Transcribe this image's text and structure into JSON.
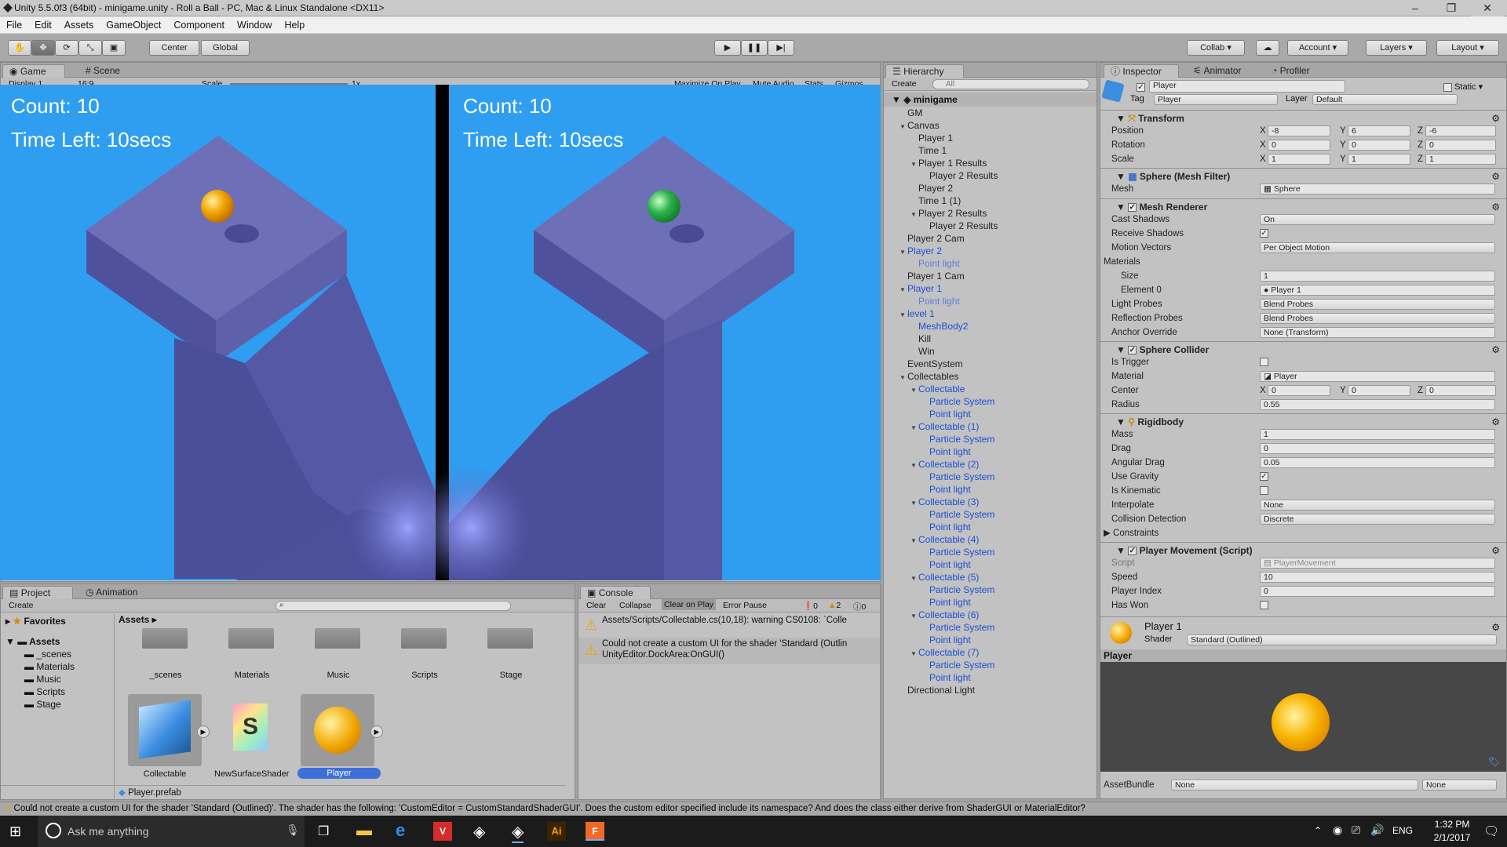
{
  "window": {
    "title": "Unity 5.5.0f3 (64bit) - minigame.unity - Roll a Ball - PC, Mac & Linux Standalone <DX11>",
    "minimize": "–",
    "maximize": "❐",
    "close": "✕"
  },
  "menu": [
    "File",
    "Edit",
    "Assets",
    "GameObject",
    "Component",
    "Window",
    "Help"
  ],
  "toolbar": {
    "center": "Center",
    "global": "Global",
    "collab": "Collab",
    "account": "Account",
    "layers": "Layers",
    "layout": "Layout"
  },
  "game": {
    "tab_game": "Game",
    "tab_scene": "Scene",
    "display": "Display 1",
    "aspect": "16:9",
    "scale_label": "Scale",
    "scale_value": "1x",
    "maximize": "Maximize On Play",
    "mute": "Mute Audio",
    "stats": "Stats",
    "gizmos": "Gizmos",
    "left_count": "Count: 10",
    "left_time": "Time Left: 10secs",
    "right_count": "Count: 10",
    "right_time": "Time Left: 10secs",
    "ball_left_color": "#f2a500",
    "ball_right_color": "#2bb24a"
  },
  "hierarchy": {
    "tab": "Hierarchy",
    "create": "Create",
    "search": "All",
    "scene": "minigame",
    "rows": [
      {
        "label": "GM",
        "depth": 1,
        "style": "",
        "tri": ""
      },
      {
        "label": "Canvas",
        "depth": 1,
        "style": "",
        "tri": "▼"
      },
      {
        "label": "Player 1",
        "depth": 2,
        "style": "",
        "tri": ""
      },
      {
        "label": "Time 1",
        "depth": 2,
        "style": "",
        "tri": ""
      },
      {
        "label": "Player 1 Results",
        "depth": 2,
        "style": "",
        "tri": "▼"
      },
      {
        "label": "Player 2 Results",
        "depth": 3,
        "style": "",
        "tri": ""
      },
      {
        "label": "Player 2",
        "depth": 2,
        "style": "",
        "tri": ""
      },
      {
        "label": "Time 1 (1)",
        "depth": 2,
        "style": "",
        "tri": ""
      },
      {
        "label": "Player 2 Results",
        "depth": 2,
        "style": "",
        "tri": "▼"
      },
      {
        "label": "Player 2 Results",
        "depth": 3,
        "style": "",
        "tri": ""
      },
      {
        "label": "Player 2 Cam",
        "depth": 1,
        "style": "",
        "tri": ""
      },
      {
        "label": "Player 2",
        "depth": 1,
        "style": "blue",
        "tri": "▼"
      },
      {
        "label": "Point light",
        "depth": 2,
        "style": "light",
        "tri": ""
      },
      {
        "label": "Player 1 Cam",
        "depth": 1,
        "style": "",
        "tri": ""
      },
      {
        "label": "Player 1",
        "depth": 1,
        "style": "blue",
        "tri": "▼"
      },
      {
        "label": "Point light",
        "depth": 2,
        "style": "light",
        "tri": ""
      },
      {
        "label": "level 1",
        "depth": 1,
        "style": "blue",
        "tri": "▼"
      },
      {
        "label": "MeshBody2",
        "depth": 2,
        "style": "blue",
        "tri": ""
      },
      {
        "label": "Kill",
        "depth": 2,
        "style": "",
        "tri": ""
      },
      {
        "label": "Win",
        "depth": 2,
        "style": "",
        "tri": ""
      },
      {
        "label": "EventSystem",
        "depth": 1,
        "style": "",
        "tri": ""
      },
      {
        "label": "Collectables",
        "depth": 1,
        "style": "",
        "tri": "▼"
      },
      {
        "label": "Collectable",
        "depth": 2,
        "style": "blue",
        "tri": "▼"
      },
      {
        "label": "Particle System",
        "depth": 3,
        "style": "blue",
        "tri": ""
      },
      {
        "label": "Point light",
        "depth": 3,
        "style": "blue",
        "tri": ""
      },
      {
        "label": "Collectable (1)",
        "depth": 2,
        "style": "blue",
        "tri": "▼"
      },
      {
        "label": "Particle System",
        "depth": 3,
        "style": "blue",
        "tri": ""
      },
      {
        "label": "Point light",
        "depth": 3,
        "style": "blue",
        "tri": ""
      },
      {
        "label": "Collectable (2)",
        "depth": 2,
        "style": "blue",
        "tri": "▼"
      },
      {
        "label": "Particle System",
        "depth": 3,
        "style": "blue",
        "tri": ""
      },
      {
        "label": "Point light",
        "depth": 3,
        "style": "blue",
        "tri": ""
      },
      {
        "label": "Collectable (3)",
        "depth": 2,
        "style": "blue",
        "tri": "▼"
      },
      {
        "label": "Particle System",
        "depth": 3,
        "style": "blue",
        "tri": ""
      },
      {
        "label": "Point light",
        "depth": 3,
        "style": "blue",
        "tri": ""
      },
      {
        "label": "Collectable (4)",
        "depth": 2,
        "style": "blue",
        "tri": "▼"
      },
      {
        "label": "Particle System",
        "depth": 3,
        "style": "blue",
        "tri": ""
      },
      {
        "label": "Point light",
        "depth": 3,
        "style": "blue",
        "tri": ""
      },
      {
        "label": "Collectable (5)",
        "depth": 2,
        "style": "blue",
        "tri": "▼"
      },
      {
        "label": "Particle System",
        "depth": 3,
        "style": "blue",
        "tri": ""
      },
      {
        "label": "Point light",
        "depth": 3,
        "style": "blue",
        "tri": ""
      },
      {
        "label": "Collectable (6)",
        "depth": 2,
        "style": "blue",
        "tri": "▼"
      },
      {
        "label": "Particle System",
        "depth": 3,
        "style": "blue",
        "tri": ""
      },
      {
        "label": "Point light",
        "depth": 3,
        "style": "blue",
        "tri": ""
      },
      {
        "label": "Collectable (7)",
        "depth": 2,
        "style": "blue",
        "tri": "▼"
      },
      {
        "label": "Particle System",
        "depth": 3,
        "style": "blue",
        "tri": ""
      },
      {
        "label": "Point light",
        "depth": 3,
        "style": "blue",
        "tri": ""
      },
      {
        "label": "Directional Light",
        "depth": 1,
        "style": "",
        "tri": ""
      }
    ]
  },
  "inspector": {
    "tabs": [
      "Inspector",
      "Animator",
      "Profiler"
    ],
    "name": "Player",
    "static": "Static",
    "tag_label": "Tag",
    "tag": "Player",
    "layer_label": "Layer",
    "layer": "Default",
    "transform": {
      "title": "Transform",
      "position": "Position",
      "rotation": "Rotation",
      "scale": "Scale",
      "x": "X",
      "y": "Y",
      "z": "Z",
      "pos": [
        "-8",
        "6",
        "-6"
      ],
      "rot": [
        "0",
        "0",
        "0"
      ],
      "scl": [
        "1",
        "1",
        "1"
      ]
    },
    "meshfilter": {
      "title": "Sphere (Mesh Filter)",
      "mesh_label": "Mesh",
      "mesh": "Sphere"
    },
    "renderer": {
      "title": "Mesh Renderer",
      "cast": "Cast Shadows",
      "cast_val": "On",
      "receive": "Receive Shadows",
      "motion": "Motion Vectors",
      "motion_val": "Per Object Motion",
      "materials": "Materials",
      "size": "Size",
      "size_val": "1",
      "element0": "Element 0",
      "element0_val": "Player 1",
      "lightprobes": "Light Probes",
      "lightprobes_val": "Blend Probes",
      "reflprobes": "Reflection Probes",
      "reflprobes_val": "Blend Probes",
      "anchor": "Anchor Override",
      "anchor_val": "None (Transform)"
    },
    "collider": {
      "title": "Sphere Collider",
      "trigger": "Is Trigger",
      "material": "Material",
      "material_val": "Player",
      "center": "Center",
      "center_vals": [
        "0",
        "0",
        "0"
      ],
      "radius": "Radius",
      "radius_val": "0.55"
    },
    "rigidbody": {
      "title": "Rigidbody",
      "mass": "Mass",
      "mass_val": "1",
      "drag": "Drag",
      "drag_val": "0",
      "adrag": "Angular Drag",
      "adrag_val": "0.05",
      "gravity": "Use Gravity",
      "kinematic": "Is Kinematic",
      "interp": "Interpolate",
      "interp_val": "None",
      "coll": "Collision Detection",
      "coll_val": "Discrete",
      "constraints": "Constraints"
    },
    "script": {
      "title": "Player Movement (Script)",
      "script": "Script",
      "script_val": "PlayerMovement",
      "speed": "Speed",
      "speed_val": "10",
      "index": "Player Index",
      "index_val": "0",
      "won": "Has Won"
    },
    "material": {
      "name": "Player 1",
      "shader_label": "Shader",
      "shader": "Standard (Outlined)"
    },
    "preview_title": "Player",
    "assetbundle": "AssetBundle",
    "ab_val": "None",
    "ab_val2": "None"
  },
  "project": {
    "tab_project": "Project",
    "tab_animation": "Animation",
    "create": "Create",
    "favorites": "Favorites",
    "assets_root": "Assets",
    "folders": [
      "_scenes",
      "Materials",
      "Music",
      "Scripts",
      "Stage"
    ],
    "breadcrumb": "Assets",
    "grid_folders": [
      "_scenes",
      "Materials",
      "Music",
      "Scripts",
      "Stage"
    ],
    "assets": [
      "Collectable",
      "NewSurfaceShader",
      "Player"
    ],
    "selected_file": "Player.prefab"
  },
  "console": {
    "tab": "Console",
    "clear": "Clear",
    "collapse": "Collapse",
    "clear_on_play": "Clear on Play",
    "error_pause": "Error Pause",
    "counts": [
      "0",
      "2",
      "0"
    ],
    "msg1": "Assets/Scripts/Collectable.cs(10,18): warning CS0108: `Colle",
    "msg2a": "Could not create a custom UI for the shader 'Standard (Outlin",
    "msg2b": "UnityEditor.DockArea:OnGUI()"
  },
  "status": "Could not create a custom UI for the shader 'Standard (Outlined)'. The shader has the following: 'CustomEditor = CustomStandardShaderGUI'. Does the custom editor specified include its namespace? And does the class either derive from ShaderGUI or MaterialEditor?",
  "taskbar": {
    "search": "Ask me anything",
    "lang": "ENG",
    "time": "1:32 PM",
    "date": "2/1/2017"
  }
}
